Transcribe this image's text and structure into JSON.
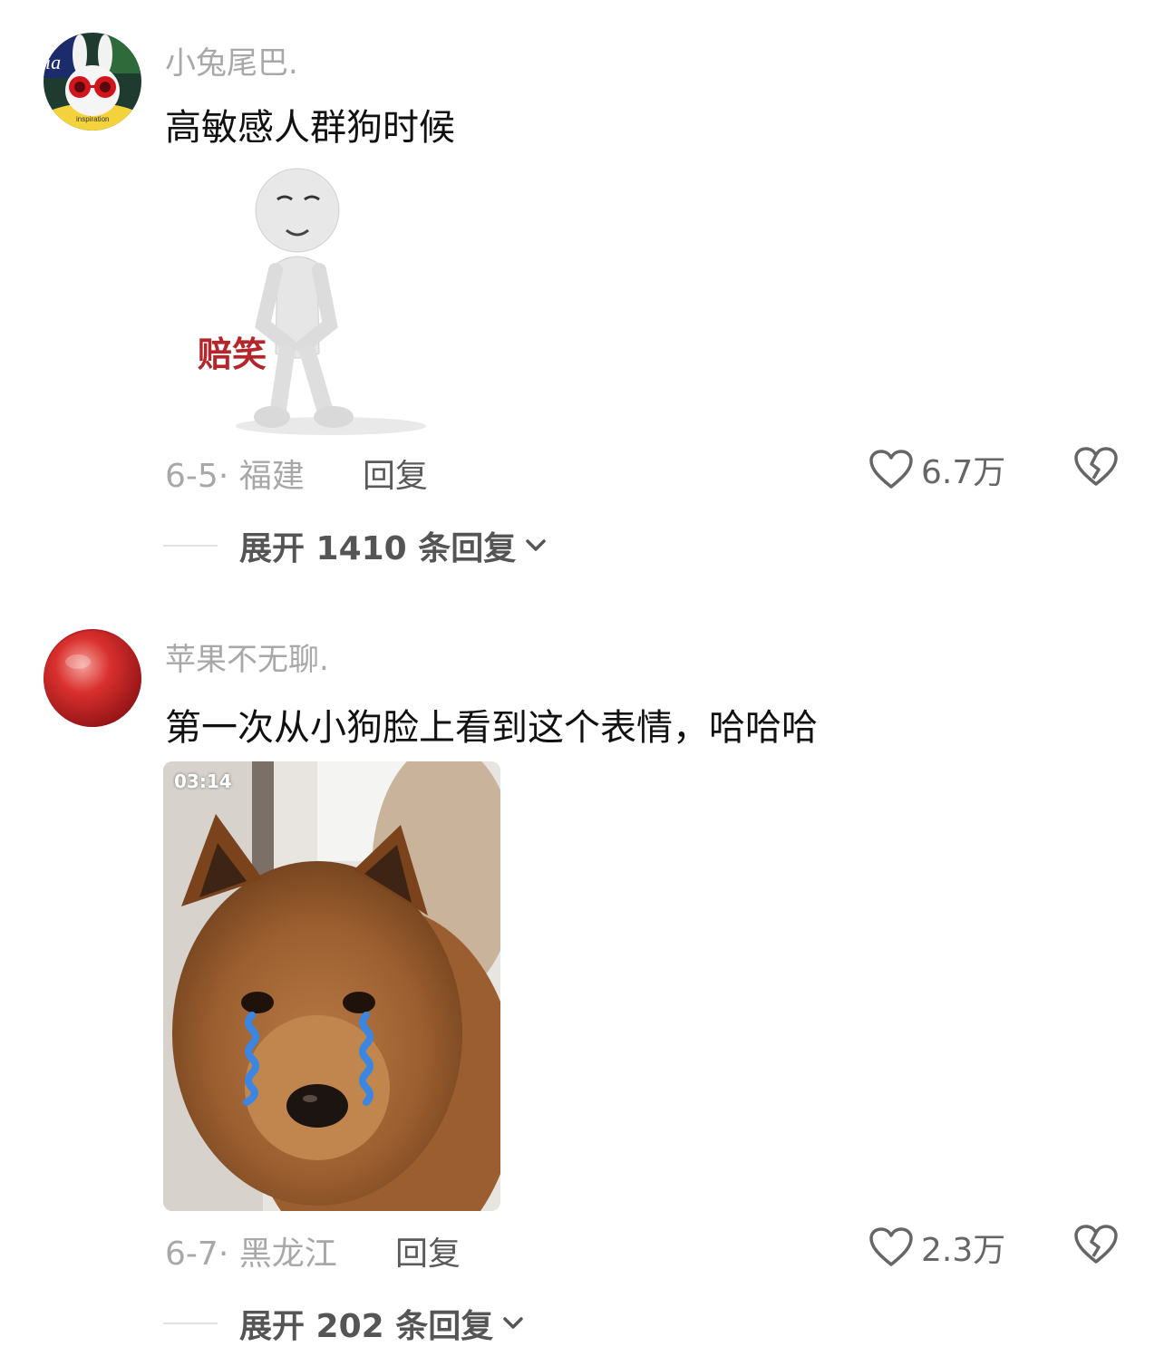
{
  "comments": [
    {
      "username": "小兔尾巴.",
      "text": "高敏感人群狗时候",
      "sticker_caption": "赔笑",
      "date": "6-5",
      "location": "福建",
      "reply_label": "回复",
      "likes": "6.7万",
      "expand_label": "展开 1410 条回复",
      "avatar_text": "inspiration",
      "avatar_icon": "bunny-sunglasses-avatar"
    },
    {
      "username": "苹果不无聊.",
      "text": "第一次从小狗脸上看到这个表情，哈哈哈",
      "video_duration": "03:14",
      "date": "6-7",
      "location": "黑龙江",
      "reply_label": "回复",
      "likes": "2.3万",
      "expand_label": "展开 202 条回复",
      "avatar_icon": "apple-avatar"
    }
  ],
  "colors": {
    "muted_text": "#a8a8a8",
    "primary_text": "#111111",
    "sticker_red": "#b3262b",
    "tear_blue": "#3a86e0"
  }
}
